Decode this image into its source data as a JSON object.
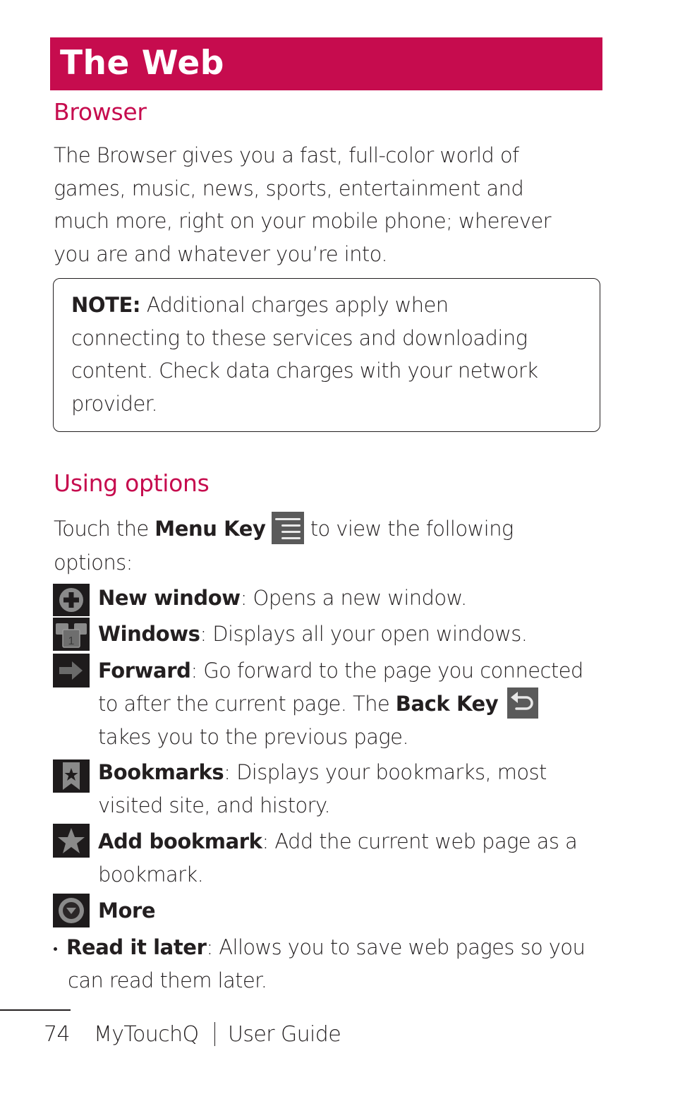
{
  "colors": {
    "accent": "#c60c4e",
    "text": "#231f20",
    "icon_bg": "#1e1b1c",
    "key_bg": "#5a5a5a"
  },
  "header": {
    "title": "The Web"
  },
  "browser_section": {
    "heading": "Browser",
    "paragraph_lines": [
      "The Browser gives you a fast, full-color world of",
      "games, music, news, sports, entertainment and",
      "much more, right on your mobile phone; wherever",
      "you are and whatever you’re into."
    ],
    "note": {
      "label": "NOTE:",
      "line1_rest": " Additional charges apply when",
      "lines": [
        "connecting to these services and downloading",
        "content. Check data charges with your network",
        "provider."
      ]
    }
  },
  "options_section": {
    "heading": "Using options",
    "intro": {
      "before": "Touch the ",
      "key_label": "Menu Key",
      "after": " to view the following",
      "line2": "options:",
      "key_icon": "menu-key-icon"
    },
    "items": [
      {
        "icon": "new-window-icon",
        "name": "New window",
        "lines": [
          ": Opens a new window."
        ]
      },
      {
        "icon": "windows-icon",
        "name": "Windows",
        "badge": "1",
        "lines": [
          ": Displays all your open windows."
        ]
      },
      {
        "icon": "forward-arrow-icon",
        "name": "Forward",
        "lines": [
          ": Go forward to the page you connected",
          "to after the current page. The ",
          "takes you to the previous page."
        ],
        "back_key_label": "Back Key",
        "back_key_icon": "back-key-icon"
      },
      {
        "icon": "bookmarks-icon",
        "name": "Bookmarks",
        "lines": [
          ": Displays your bookmarks, most",
          "visited site, and history."
        ]
      },
      {
        "icon": "add-bookmark-icon",
        "name": "Add bookmark",
        "lines": [
          ": Add the current web page as a",
          "bookmark."
        ]
      },
      {
        "icon": "more-icon",
        "name": "More",
        "lines": []
      }
    ],
    "sub_bullets": [
      {
        "name": "Read it later",
        "lines": [
          ": Allows you to save web pages so you",
          "can read them later."
        ]
      }
    ]
  },
  "footer": {
    "page_number": "74",
    "product": "MyTouchQ",
    "guide": "User Guide"
  }
}
